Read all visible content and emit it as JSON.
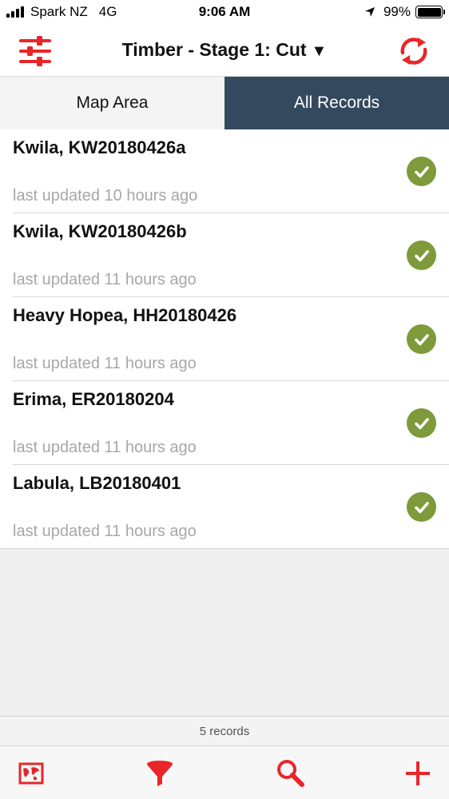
{
  "status_bar": {
    "carrier": "Spark NZ",
    "network": "4G",
    "time": "9:06 AM",
    "battery": "99%"
  },
  "nav": {
    "title": "Timber - Stage 1: Cut",
    "caret": "▼",
    "left_icon": "settings-sliders-icon",
    "right_icon": "sync-icon"
  },
  "tabs": [
    {
      "label": "Map Area",
      "selected": false
    },
    {
      "label": "All Records",
      "selected": true
    }
  ],
  "records": [
    {
      "title": "Kwila, KW20180426a",
      "subtitle": "last updated 10 hours ago",
      "status_icon": "check-circle-icon"
    },
    {
      "title": "Kwila, KW20180426b",
      "subtitle": "last updated 11 hours ago",
      "status_icon": "check-circle-icon"
    },
    {
      "title": "Heavy Hopea, HH20180426",
      "subtitle": "last updated 11 hours ago",
      "status_icon": "check-circle-icon"
    },
    {
      "title": "Erima, ER20180204",
      "subtitle": "last updated 11 hours ago",
      "status_icon": "check-circle-icon"
    },
    {
      "title": "Labula, LB20180401",
      "subtitle": "last updated 11 hours ago",
      "status_icon": "check-circle-icon"
    }
  ],
  "footer": {
    "count": "5 records"
  },
  "toolbar": [
    {
      "icon": "map-icon"
    },
    {
      "icon": "filter-icon"
    },
    {
      "icon": "search-icon"
    },
    {
      "icon": "add-icon"
    }
  ],
  "colors": {
    "accent_red": "#e8262a",
    "tab_selected": "#34495e",
    "check_green": "#7e9a3a",
    "subtitle_gray": "#a7a7a7"
  }
}
